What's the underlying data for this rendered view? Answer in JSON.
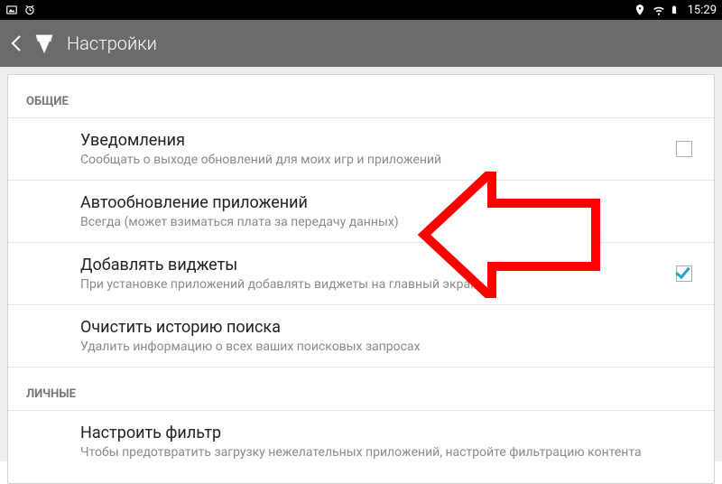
{
  "status": {
    "time": "15:29"
  },
  "appbar": {
    "title": "Настройки"
  },
  "sections": {
    "general": {
      "header": "ОБЩИЕ",
      "items": [
        {
          "title": "Уведомления",
          "sub": "Сообщать о выходе обновлений для моих игр и приложений",
          "checkbox": true,
          "checked": false
        },
        {
          "title": "Автообновление приложений",
          "sub": "Всегда (может взиматься плата за передачу данных)",
          "checkbox": false
        },
        {
          "title": "Добавлять виджеты",
          "sub": "При установке приложений добавлять виджеты на главный экран",
          "checkbox": true,
          "checked": true
        },
        {
          "title": "Очистить историю поиска",
          "sub": "Удалить информацию о всех ваших поисковых запросах",
          "checkbox": false
        }
      ]
    },
    "personal": {
      "header": "ЛИЧНЫЕ",
      "items": [
        {
          "title": "Настроить фильтр",
          "sub": "Чтобы предотвратить загрузку нежелательных приложений, настройте фильтрацию контента",
          "checkbox": false
        }
      ]
    }
  }
}
